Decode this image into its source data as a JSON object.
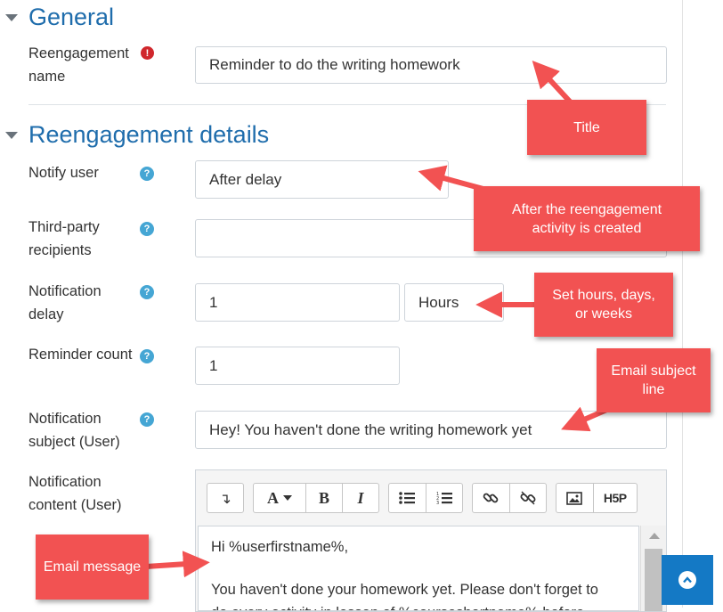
{
  "sections": {
    "general": "General",
    "details": "Reengagement details"
  },
  "labels": {
    "reengagement_name": "Reengagement name",
    "notify_user": "Notify user",
    "third_party": "Third-party recipients",
    "notification_delay": "Notification delay",
    "reminder_count": "Reminder count",
    "notification_subject": "Notification subject (User)",
    "notification_content": "Notification content (User)"
  },
  "fields": {
    "reengagement_name": "Reminder to do the writing homework",
    "notify_user": "After delay",
    "third_party": "",
    "delay_value": "1",
    "delay_unit": "Hours",
    "reminder_count": "1",
    "subject": "Hey! You haven't done the writing homework yet"
  },
  "editor": {
    "toolbar": {
      "collapse": "↴",
      "font": "A",
      "bold": "B",
      "italic": "I",
      "h5p": "H5P"
    },
    "content": {
      "line1": "Hi %userfirstname%,",
      "line2": "You haven't done your homework yet. Please don't forget to",
      "line3": "do every activity in lesson of %courseshortname% before"
    }
  },
  "callouts": {
    "title": "Title",
    "after_delay": "After the reengagement activity is created",
    "set_hours": "Set hours, days, or weeks",
    "email_subject": "Email subject line",
    "email_message": "Email message"
  },
  "icons": {
    "required": "exclamation-icon",
    "help": "question-icon",
    "back_to_top": "chevron-up-icon"
  },
  "colors": {
    "heading": "#1f6dac",
    "callout": "#f25252",
    "help": "#45a6d4",
    "required": "#d0272c",
    "back_to_top": "#1479c5"
  }
}
